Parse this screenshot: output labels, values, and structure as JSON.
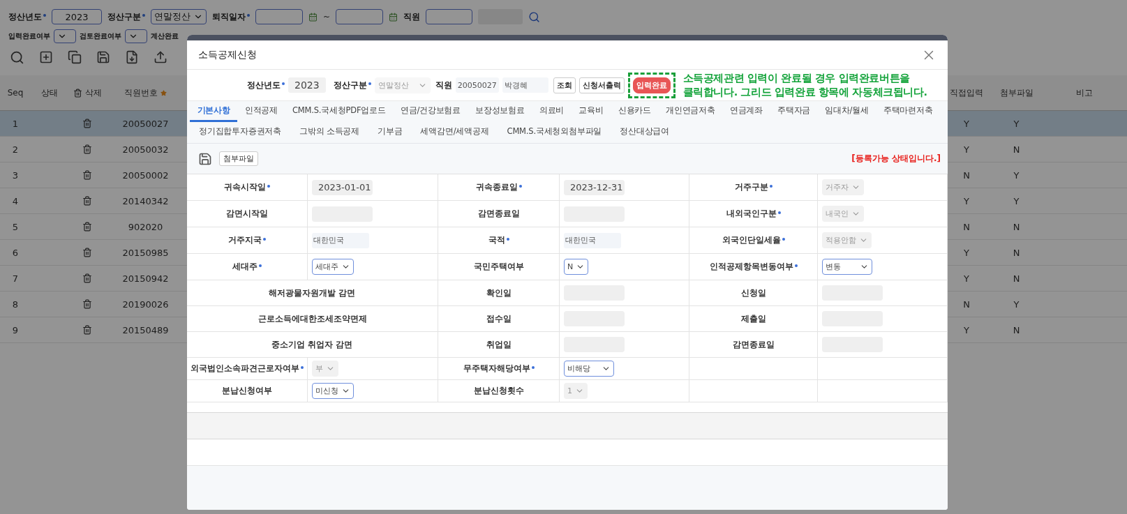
{
  "filters": [
    {
      "kind": "text",
      "label": "정산년도",
      "required": true,
      "value": "2023"
    },
    {
      "kind": "select",
      "label": "정산구분",
      "required": true,
      "value": "연말정산"
    },
    {
      "kind": "daterange",
      "label": "퇴직일자",
      "required": true,
      "separator": "~"
    },
    {
      "kind": "employee",
      "label": "직원",
      "required": false
    }
  ],
  "filters_row2": [
    {
      "kind": "select",
      "label": "입력완료여부"
    },
    {
      "kind": "select",
      "label": "검토완료여부"
    },
    {
      "kind": "label",
      "label": "계산완료"
    }
  ],
  "grid": {
    "columns": [
      {
        "label": "Seq"
      },
      {
        "label": "상태"
      },
      {
        "label": "삭제",
        "kind": "delete"
      },
      {
        "label": "직원번호",
        "required": true
      },
      {
        "label": "직접입력"
      },
      {
        "label": "첨부파일"
      },
      {
        "label": "비고"
      }
    ],
    "rows": [
      {
        "seq": "1",
        "employee_no": "20050027",
        "direct_input": "Y",
        "attachment": "Y",
        "selected": true
      },
      {
        "seq": "2",
        "employee_no": "20050032",
        "direct_input": "Y",
        "attachment": "N",
        "selected": false
      },
      {
        "seq": "3",
        "employee_no": "20050002",
        "direct_input": "N",
        "attachment": "Y",
        "selected": false
      },
      {
        "seq": "4",
        "employee_no": "20140342",
        "direct_input": "Y",
        "attachment": "Y",
        "selected": false
      },
      {
        "seq": "5",
        "employee_no": "902020",
        "direct_input": "N",
        "attachment": "N",
        "selected": false
      },
      {
        "seq": "6",
        "employee_no": "20150985",
        "direct_input": "Y",
        "attachment": "N",
        "selected": false
      },
      {
        "seq": "7",
        "employee_no": "20150942",
        "direct_input": "Y",
        "attachment": "N",
        "selected": false
      },
      {
        "seq": "8",
        "employee_no": "20190026",
        "direct_input": "N",
        "attachment": "Y",
        "selected": false
      },
      {
        "seq": "9",
        "employee_no": "20150489",
        "direct_input": "Y",
        "attachment": "N",
        "selected": false
      }
    ]
  },
  "modal": {
    "title": "소득공제신청",
    "head": {
      "year_label": "정산년도",
      "year": "2023",
      "type_label": "정산구분",
      "type": "연말정산",
      "employee_label": "직원",
      "employee_no": "20050027",
      "employee_name": "박경혜",
      "buttons": [
        {
          "label": "조회",
          "kind": "plain",
          "highlighted": false
        },
        {
          "label": "신청서출력",
          "kind": "plain",
          "highlighted": false
        },
        {
          "label": "입력완료",
          "kind": "primary",
          "highlighted": true
        }
      ]
    },
    "annotation": [
      "소득공제관련 입력이 완료될 경우 입력완료버튼을",
      "클릭합니다. 그리드 입력완료 항목에 자동체크됩니다."
    ],
    "tabs": [
      [
        {
          "label": "기본사항",
          "selected": true
        },
        {
          "label": "인적공제",
          "selected": false
        },
        {
          "label": "CMM.S.국세청PDF업로드",
          "selected": false
        },
        {
          "label": "연금/건강보험료",
          "selected": false
        },
        {
          "label": "보장성보험료",
          "selected": false
        },
        {
          "label": "의료비",
          "selected": false
        },
        {
          "label": "교육비",
          "selected": false
        },
        {
          "label": "신용카드",
          "selected": false
        },
        {
          "label": "개인연금저축",
          "selected": false
        },
        {
          "label": "연금계좌",
          "selected": false
        },
        {
          "label": "주택자금",
          "selected": false
        },
        {
          "label": "임대차/월세",
          "selected": false
        },
        {
          "label": "주택마련저축",
          "selected": false
        }
      ],
      [
        {
          "label": "정기집합투자증권저축",
          "selected": false
        },
        {
          "label": "그밖의 소득공제",
          "selected": false
        },
        {
          "label": "기부금",
          "selected": false
        },
        {
          "label": "세액감면/세액공제",
          "selected": false
        },
        {
          "label": "CMM.S.국세청외첨부파일",
          "selected": false
        },
        {
          "label": "정산대상급여",
          "selected": false
        }
      ]
    ],
    "form_toolbar": {
      "button": "첨부파일",
      "status": "[등록가능 상태입니다.]"
    },
    "form": {
      "rows": [
        {
          "cells": [
            {
              "kind": "label",
              "text": "귀속시작일",
              "required": true
            },
            {
              "kind": "date",
              "value": "2023-01-01"
            },
            {
              "kind": "label",
              "text": "귀속종료일",
              "required": true
            },
            {
              "kind": "date",
              "value": "2023-12-31"
            },
            {
              "kind": "label",
              "text": "거주구분",
              "required": true
            },
            {
              "kind": "select",
              "value": "거주자",
              "disabled": true,
              "wide": false
            }
          ]
        },
        {
          "cells": [
            {
              "kind": "label",
              "text": "감면시작일",
              "required": false
            },
            {
              "kind": "date"
            },
            {
              "kind": "label",
              "text": "감면종료일",
              "required": false
            },
            {
              "kind": "date"
            },
            {
              "kind": "label",
              "text": "내외국인구분",
              "required": true
            },
            {
              "kind": "select",
              "value": "내국인",
              "disabled": true,
              "wide": false
            }
          ]
        },
        {
          "cells": [
            {
              "kind": "label",
              "text": "거주지국",
              "required": true
            },
            {
              "kind": "text",
              "value": "대한민국"
            },
            {
              "kind": "label",
              "text": "국적",
              "required": true
            },
            {
              "kind": "text",
              "value": "대한민국"
            },
            {
              "kind": "label",
              "text": "외국인단일세율",
              "required": true
            },
            {
              "kind": "select",
              "value": "적용안함",
              "disabled": true,
              "wide": false
            }
          ]
        },
        {
          "cells": [
            {
              "kind": "label",
              "text": "세대주",
              "required": true
            },
            {
              "kind": "select",
              "value": "세대주",
              "disabled": false,
              "wide": false
            },
            {
              "kind": "label",
              "text": "국민주택여부",
              "required": false
            },
            {
              "kind": "select",
              "value": "N",
              "disabled": false,
              "wide": false
            },
            {
              "kind": "label",
              "text": "인적공제항목변동여부",
              "required": true
            },
            {
              "kind": "select",
              "value": "변동",
              "disabled": false,
              "wide": true
            }
          ]
        },
        {
          "cells": [
            {
              "kind": "wide_label",
              "text": "해저광물자원개발 감면",
              "required": false
            },
            {
              "kind": "label",
              "text": "확인일",
              "required": false
            },
            {
              "kind": "date"
            },
            {
              "kind": "label",
              "text": "신청일",
              "required": false
            },
            {
              "kind": "date"
            }
          ]
        },
        {
          "cells": [
            {
              "kind": "wide_label",
              "text": "근로소득에대한조세조약면제",
              "required": false
            },
            {
              "kind": "label",
              "text": "접수일",
              "required": false
            },
            {
              "kind": "date"
            },
            {
              "kind": "label",
              "text": "제출일",
              "required": false
            },
            {
              "kind": "date"
            }
          ]
        },
        {
          "cells": [
            {
              "kind": "wide_label",
              "text": "중소기업 취업자 감면",
              "required": false
            },
            {
              "kind": "label",
              "text": "취업일",
              "required": false
            },
            {
              "kind": "date"
            },
            {
              "kind": "label",
              "text": "감면종료일",
              "required": false
            },
            {
              "kind": "date"
            }
          ]
        },
        {
          "cells": [
            {
              "kind": "label",
              "text": "외국법인소속파견근로자여부",
              "required": true
            },
            {
              "kind": "select",
              "value": "부",
              "disabled": true,
              "wide": false
            },
            {
              "kind": "label",
              "text": "무주택자해당여부",
              "required": true
            },
            {
              "kind": "select",
              "value": "비해당",
              "disabled": false,
              "wide": true
            },
            {
              "kind": "blank"
            },
            {
              "kind": "blank"
            }
          ]
        },
        {
          "cells": [
            {
              "kind": "label",
              "text": "분납신청여부",
              "required": false
            },
            {
              "kind": "select",
              "value": "미신청",
              "disabled": false,
              "wide": false
            },
            {
              "kind": "label",
              "text": "분납신청횟수",
              "required": false
            },
            {
              "kind": "select",
              "value": "1",
              "disabled": true,
              "wide": false
            },
            {
              "kind": "blank"
            },
            {
              "kind": "blank"
            }
          ]
        }
      ]
    }
  }
}
